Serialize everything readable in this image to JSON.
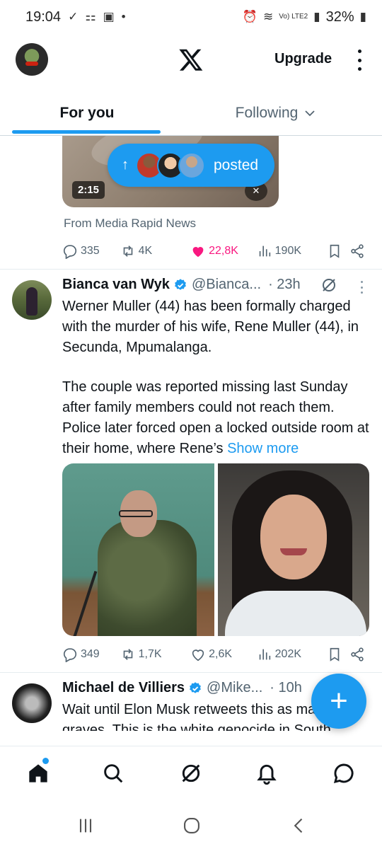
{
  "status_bar": {
    "time": "19:04",
    "battery": "32%",
    "network": "Vo) LTE2"
  },
  "header": {
    "upgrade_label": "Upgrade",
    "logo_icon": "x-logo-icon",
    "avatar_icon": "profile-avatar"
  },
  "tabs": [
    {
      "label": "For you",
      "active": true
    },
    {
      "label": "Following",
      "active": false
    }
  ],
  "posted_pill": {
    "label": "posted"
  },
  "tweet_1": {
    "video_duration": "2:15",
    "source": "From  Media Rapid News",
    "replies": "335",
    "retweets": "4K",
    "likes": "22,8K",
    "liked": true,
    "views": "190K"
  },
  "tweet_2": {
    "name": "Bianca van Wyk",
    "handle": "@Bianca...",
    "time": "· 23h",
    "verified": true,
    "paragraph_1": "Werner Muller (44) has been formally charged with the murder of his wife, Rene Muller (44), in Secunda, Mpumalanga.",
    "paragraph_2": "The couple was reported missing last Sunday after family members could not reach them. Police later forced open a locked outside room at their home, where Rene’s",
    "show_more": "Show more",
    "replies": "349",
    "retweets": "1,7K",
    "likes": "2,6K",
    "views": "202K"
  },
  "tweet_3": {
    "name": "Michael de Villiers",
    "handle": "@Mike...",
    "time": "· 10h",
    "verified": true,
    "text_visible": "Wait until Elon Musk retweets this as mass graves. This is the white genocide in South"
  },
  "fab": {
    "label": "+"
  },
  "colors": {
    "accent": "#1d9bf0",
    "like": "#f91880",
    "secondary_text": "#536471"
  }
}
